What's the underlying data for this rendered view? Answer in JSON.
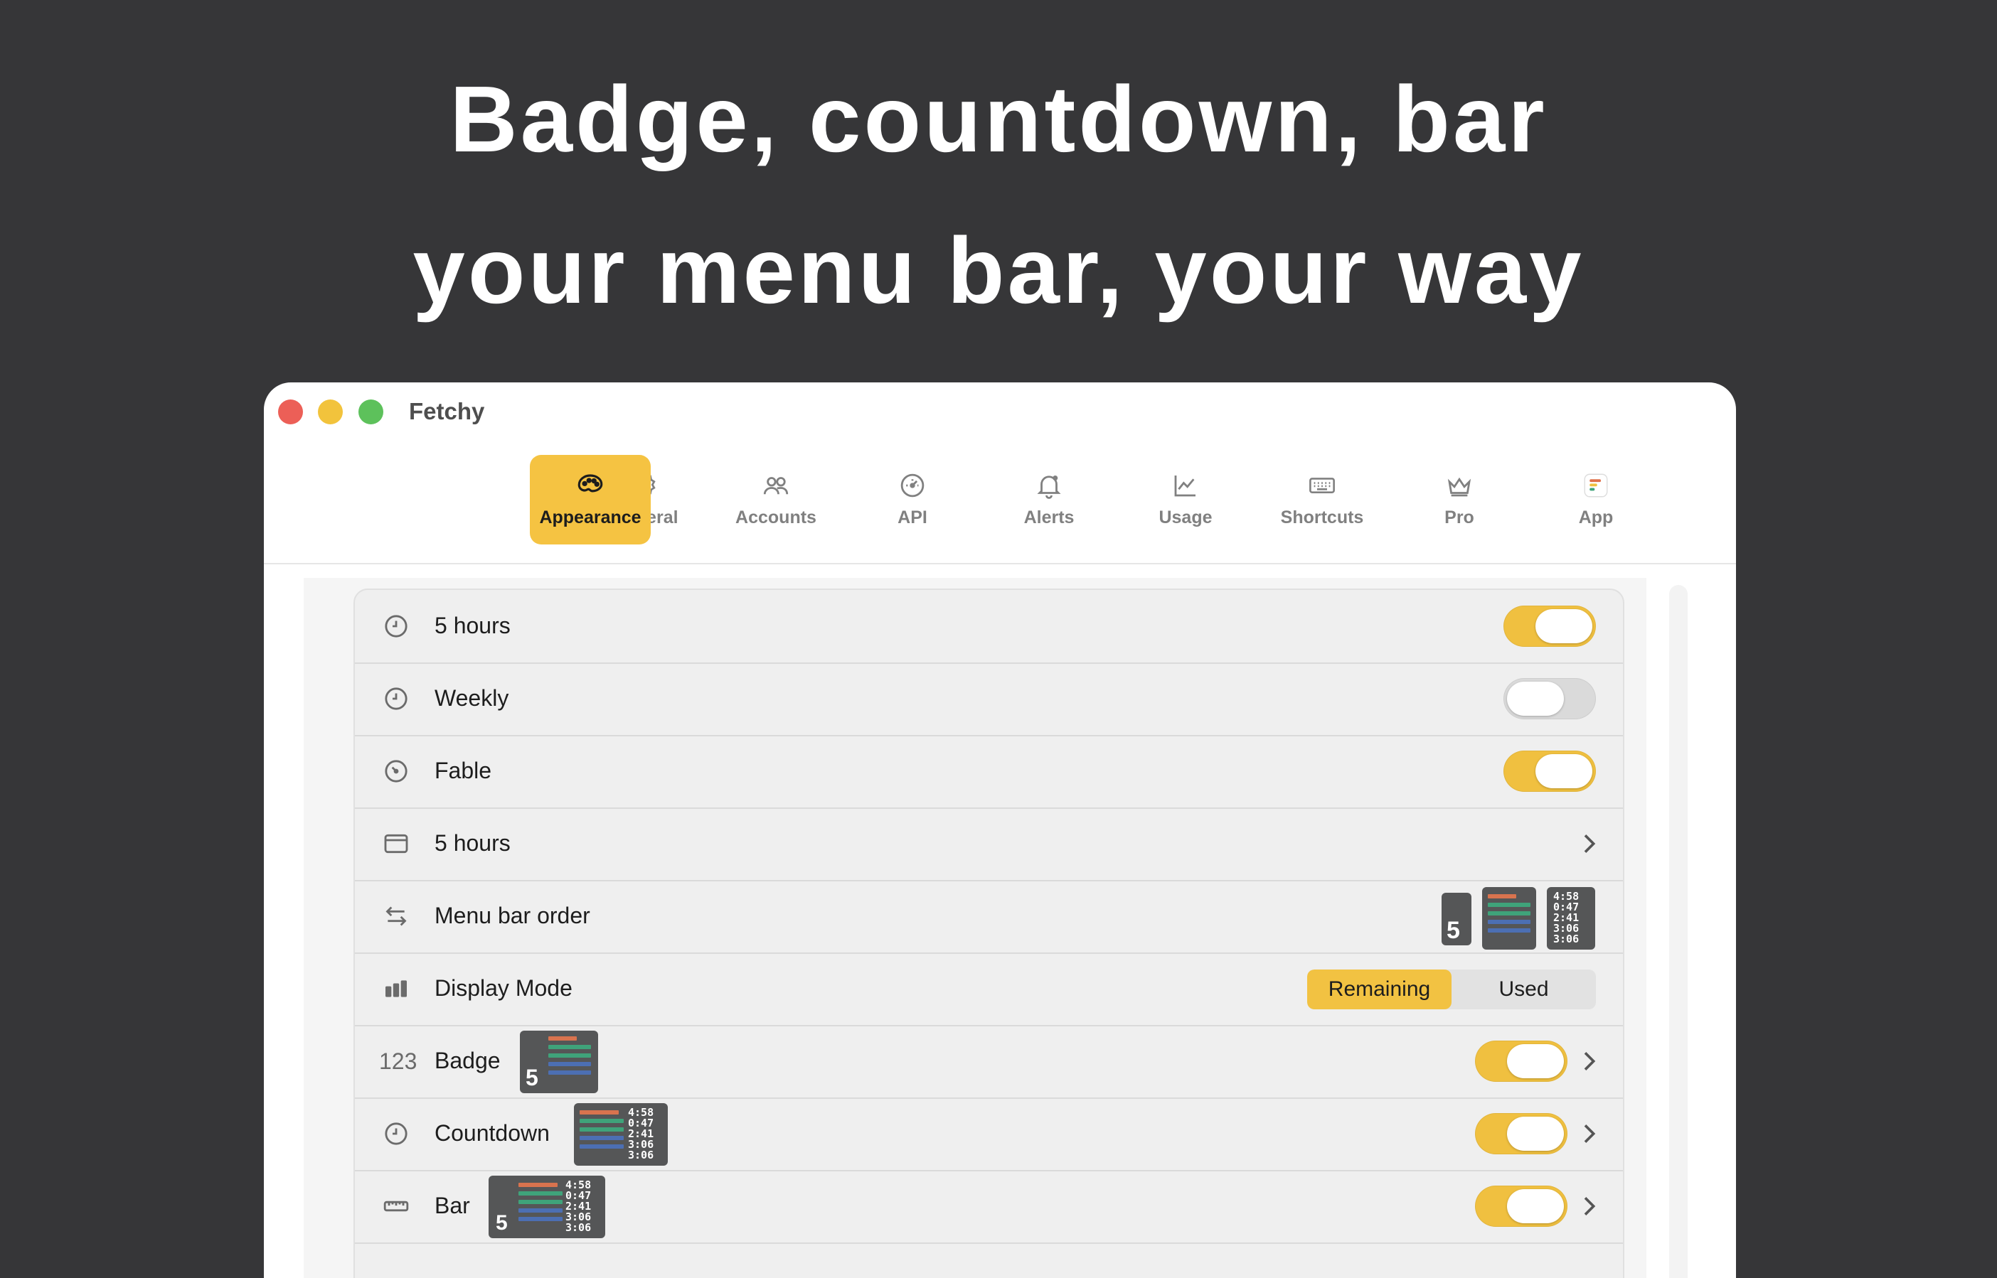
{
  "headline": {
    "line1": "Badge, countdown, bar",
    "line2": "your menu bar, your way"
  },
  "window": {
    "title": "Fetchy"
  },
  "tabs": [
    {
      "label": "General",
      "icon": "gear-icon"
    },
    {
      "label": "Appearance",
      "icon": "palette-icon",
      "active": true
    },
    {
      "label": "Accounts",
      "icon": "people-icon"
    },
    {
      "label": "API",
      "icon": "gauge-icon"
    },
    {
      "label": "Alerts",
      "icon": "bell-icon"
    },
    {
      "label": "Usage",
      "icon": "chart-icon"
    },
    {
      "label": "Shortcuts",
      "icon": "keyboard-icon"
    },
    {
      "label": "Pro",
      "icon": "crown-icon"
    },
    {
      "label": "App",
      "icon": "app-logo-icon"
    }
  ],
  "rows": [
    {
      "label": "5 hours",
      "icon": "clock-icon",
      "toggle": "on"
    },
    {
      "label": "Weekly",
      "icon": "clock-icon",
      "toggle": "off"
    },
    {
      "label": "Fable",
      "icon": "speedometer-icon",
      "toggle": "on"
    },
    {
      "label": "5 hours",
      "icon": "window-icon",
      "chevron": true
    },
    {
      "label": "Menu bar order",
      "icon": "swap-arrows-icon"
    },
    {
      "label": "Display Mode",
      "icon": "bar-chart-icon",
      "segments": [
        "Remaining",
        "Used"
      ],
      "selected": "Remaining"
    },
    {
      "label": "Badge",
      "icon_text": "123",
      "toggle": "on",
      "chevron": true
    },
    {
      "label": "Countdown",
      "icon": "clock-icon",
      "toggle": "on",
      "chevron": true
    },
    {
      "label": "Bar",
      "icon": "ruler-icon",
      "toggle": "on",
      "chevron": true
    }
  ],
  "preview": {
    "badge_number": "5",
    "times": [
      "4:58",
      "0:47",
      "2:41",
      "3:06",
      "3:06"
    ],
    "bar_colors": [
      "#d8734e",
      "#3fa37a",
      "#3fa37a",
      "#4c6fb3",
      "#4c6fb3"
    ]
  },
  "colors": {
    "accent": "#f5c342",
    "background": "#363638"
  }
}
